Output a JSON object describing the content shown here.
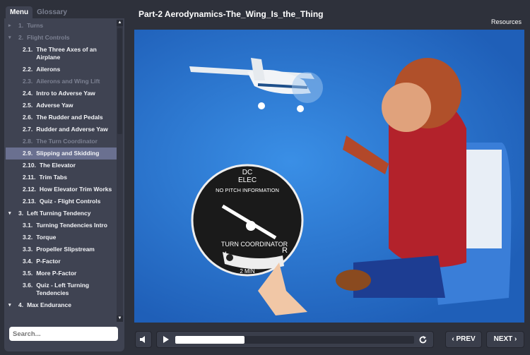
{
  "tabs": {
    "menu": "Menu",
    "glossary": "Glossary"
  },
  "menu": [
    {
      "num": "1.",
      "label": "Turns",
      "level": 1,
      "arrow": "▸",
      "state": "dim"
    },
    {
      "num": "2.",
      "label": "Flight Controls",
      "level": 1,
      "arrow": "▾",
      "state": "dim"
    },
    {
      "num": "2.1.",
      "label": "The Three Axes of an Airplane",
      "level": 2,
      "state": ""
    },
    {
      "num": "2.2.",
      "label": "Ailerons",
      "level": 2,
      "state": ""
    },
    {
      "num": "2.3.",
      "label": "Ailerons and Wing Lift",
      "level": 2,
      "state": "dim"
    },
    {
      "num": "2.4.",
      "label": "Intro to Adverse Yaw",
      "level": 2,
      "state": ""
    },
    {
      "num": "2.5.",
      "label": "Adverse Yaw",
      "level": 2,
      "state": ""
    },
    {
      "num": "2.6.",
      "label": "The Rudder and Pedals",
      "level": 2,
      "state": ""
    },
    {
      "num": "2.7.",
      "label": "Rudder and Adverse Yaw",
      "level": 2,
      "state": ""
    },
    {
      "num": "2.8.",
      "label": "The Turn Coordinator",
      "level": 2,
      "state": "dim"
    },
    {
      "num": "2.9.",
      "label": "Slipping and Skidding",
      "level": 2,
      "state": "sel"
    },
    {
      "num": "2.10.",
      "label": "The Elevator",
      "level": 2,
      "state": ""
    },
    {
      "num": "2.11.",
      "label": "Trim Tabs",
      "level": 2,
      "state": ""
    },
    {
      "num": "2.12.",
      "label": "How Elevator Trim Works",
      "level": 2,
      "state": ""
    },
    {
      "num": "2.13.",
      "label": "Quiz - Flight Controls",
      "level": 2,
      "state": ""
    },
    {
      "num": "3.",
      "label": "Left Turning Tendency",
      "level": 1,
      "arrow": "▾",
      "state": ""
    },
    {
      "num": "3.1.",
      "label": "Turning Tendencies Intro",
      "level": 2,
      "state": ""
    },
    {
      "num": "3.2.",
      "label": "Torque",
      "level": 2,
      "state": ""
    },
    {
      "num": "3.3.",
      "label": "Propeller Slipstream",
      "level": 2,
      "state": ""
    },
    {
      "num": "3.4.",
      "label": "P-Factor",
      "level": 2,
      "state": ""
    },
    {
      "num": "3.5.",
      "label": "More P-Factor",
      "level": 2,
      "state": ""
    },
    {
      "num": "3.6.",
      "label": "Quiz - Left Turning Tendencies",
      "level": 2,
      "state": ""
    },
    {
      "num": "4.",
      "label": "Max Endurance",
      "level": 1,
      "arrow": "▾",
      "state": ""
    }
  ],
  "search": {
    "placeholder": "Search..."
  },
  "header": {
    "title": "Part-2 Aerodynamics-The_Wing_Is_the_Thing",
    "resources": "Resources"
  },
  "instrument": {
    "top1": "DC",
    "top2": "ELEC",
    "pitch": "NO PITCH INFORMATION",
    "name": "TURN COORDINATOR",
    "left": "L",
    "right": "R",
    "min": "2 MIN"
  },
  "player": {
    "progress": 0.29,
    "prev": "PREV",
    "next": "NEXT"
  }
}
